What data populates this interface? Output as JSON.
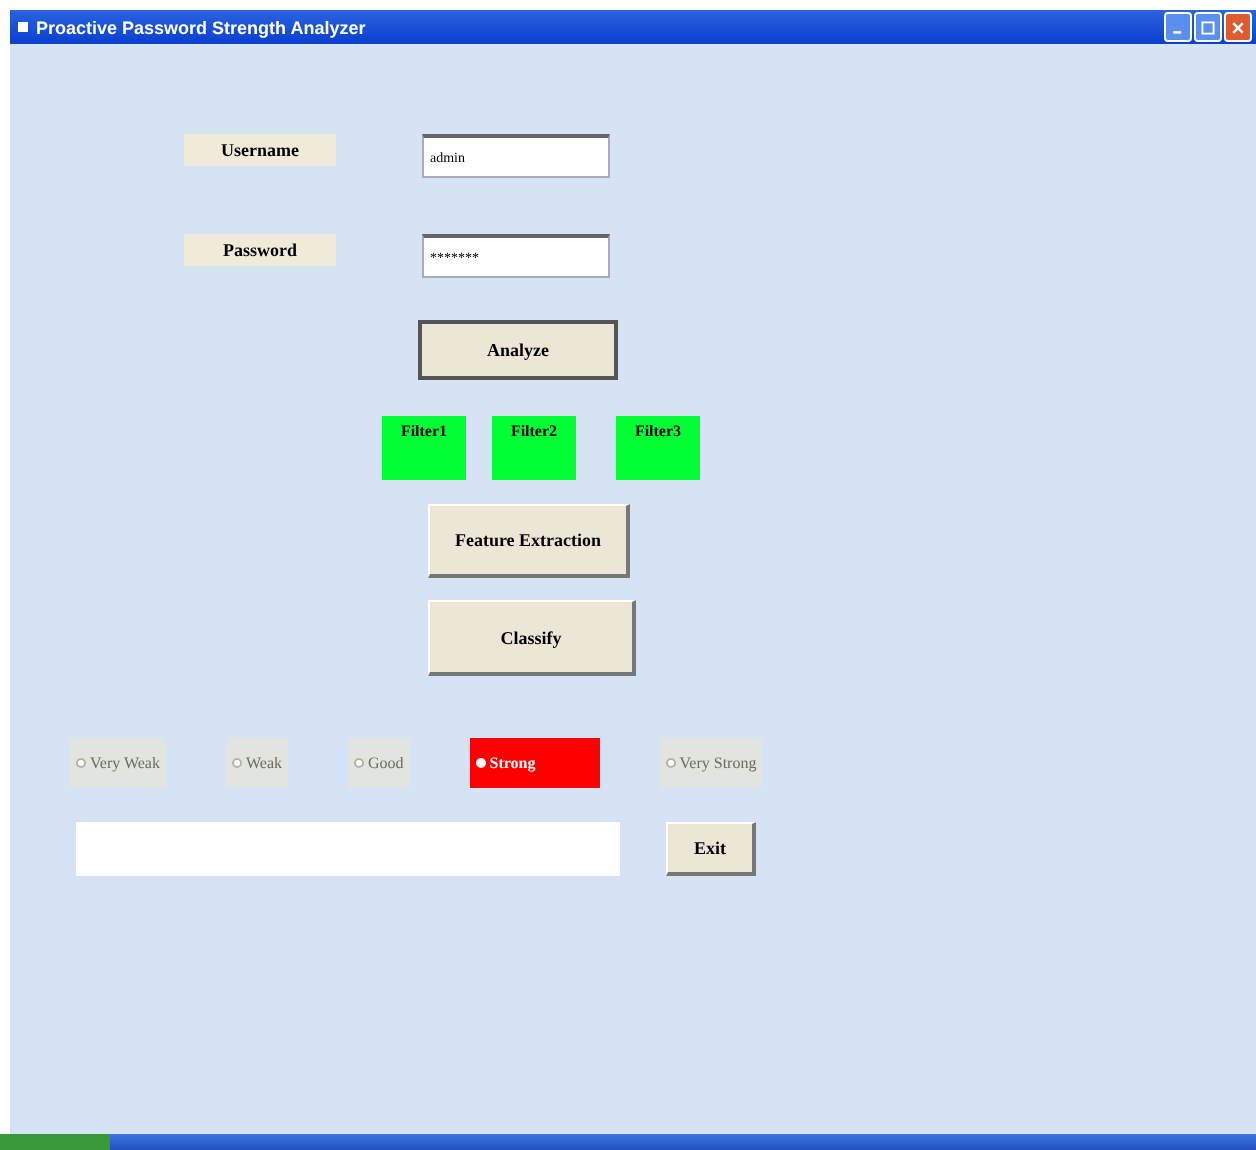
{
  "window": {
    "title": "Proactive Password Strength Analyzer"
  },
  "fields": [
    {
      "label": "Username",
      "value": "admin"
    },
    {
      "label": "Password",
      "value": "*******"
    }
  ],
  "analyze_button": "Analyze",
  "filters": [
    {
      "label": "Filter1",
      "color": "#00ff33"
    },
    {
      "label": "Filter2",
      "color": "#00ff33"
    },
    {
      "label": "Filter3",
      "color": "#00ff33"
    }
  ],
  "feature_button": "Feature Extraction",
  "classify_button": "Classify",
  "strength": [
    {
      "label": "Very Weak",
      "selected": false
    },
    {
      "label": "Weak",
      "selected": false
    },
    {
      "label": "Good",
      "selected": false
    },
    {
      "label": "Strong",
      "selected": true
    },
    {
      "label": "Very Strong",
      "selected": false
    }
  ],
  "exit_button": "Exit"
}
